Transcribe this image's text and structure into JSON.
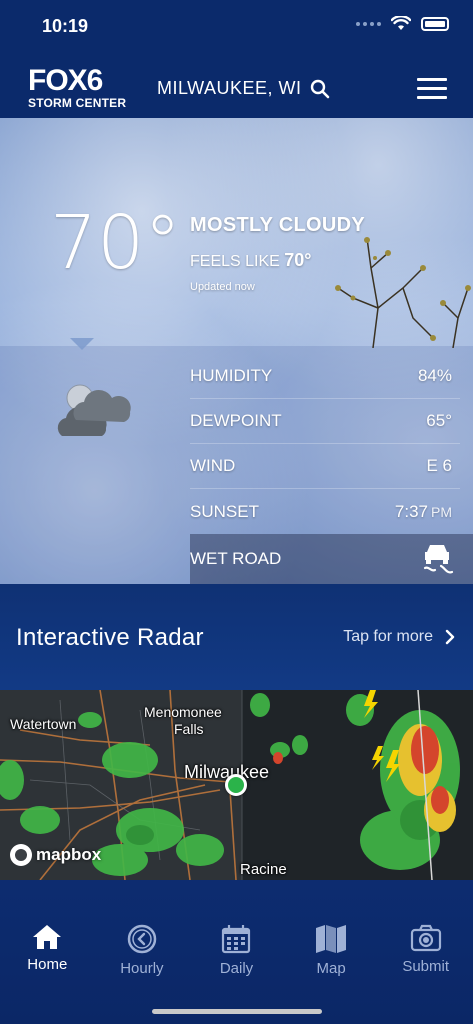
{
  "status_bar": {
    "time": "10:19"
  },
  "header": {
    "logo_main": "FOX6",
    "logo_sub": "STORM CENTER",
    "location": "MILWAUKEE, WI"
  },
  "current": {
    "temperature": "70°",
    "condition": "MOSTLY CLOUDY",
    "feels_like_label": "FEELS LIKE",
    "feels_like_value": "70°",
    "updated": "Updated now",
    "stats": [
      {
        "label": "HUMIDITY",
        "value": "84%",
        "unit": ""
      },
      {
        "label": "DEWPOINT",
        "value": "65°",
        "unit": ""
      },
      {
        "label": "WIND",
        "value": "E 6",
        "unit": ""
      },
      {
        "label": "SUNSET",
        "value": "7:37",
        "unit": "PM"
      }
    ],
    "alert": {
      "label": "WET ROAD",
      "icon": "slippery-road-icon"
    }
  },
  "radar": {
    "title": "Interactive Radar",
    "more_label": "Tap for more",
    "map_labels": {
      "watertown": "Watertown",
      "menomonee": "Menomonee",
      "falls": "Falls",
      "milwaukee": "Milwaukee",
      "racine": "Racine"
    },
    "attribution": "mapbox"
  },
  "tabs": [
    {
      "label": "Home",
      "icon": "home-icon",
      "active": true
    },
    {
      "label": "Hourly",
      "icon": "clock-icon",
      "active": false
    },
    {
      "label": "Daily",
      "icon": "calendar-icon",
      "active": false
    },
    {
      "label": "Map",
      "icon": "map-icon",
      "active": false
    },
    {
      "label": "Submit",
      "icon": "camera-icon",
      "active": false
    }
  ],
  "colors": {
    "brand_navy": "#0b2a6b",
    "active_tab": "#ffffff",
    "inactive_tab": "#9fb1d6",
    "location_pin": "#2bb34a"
  }
}
